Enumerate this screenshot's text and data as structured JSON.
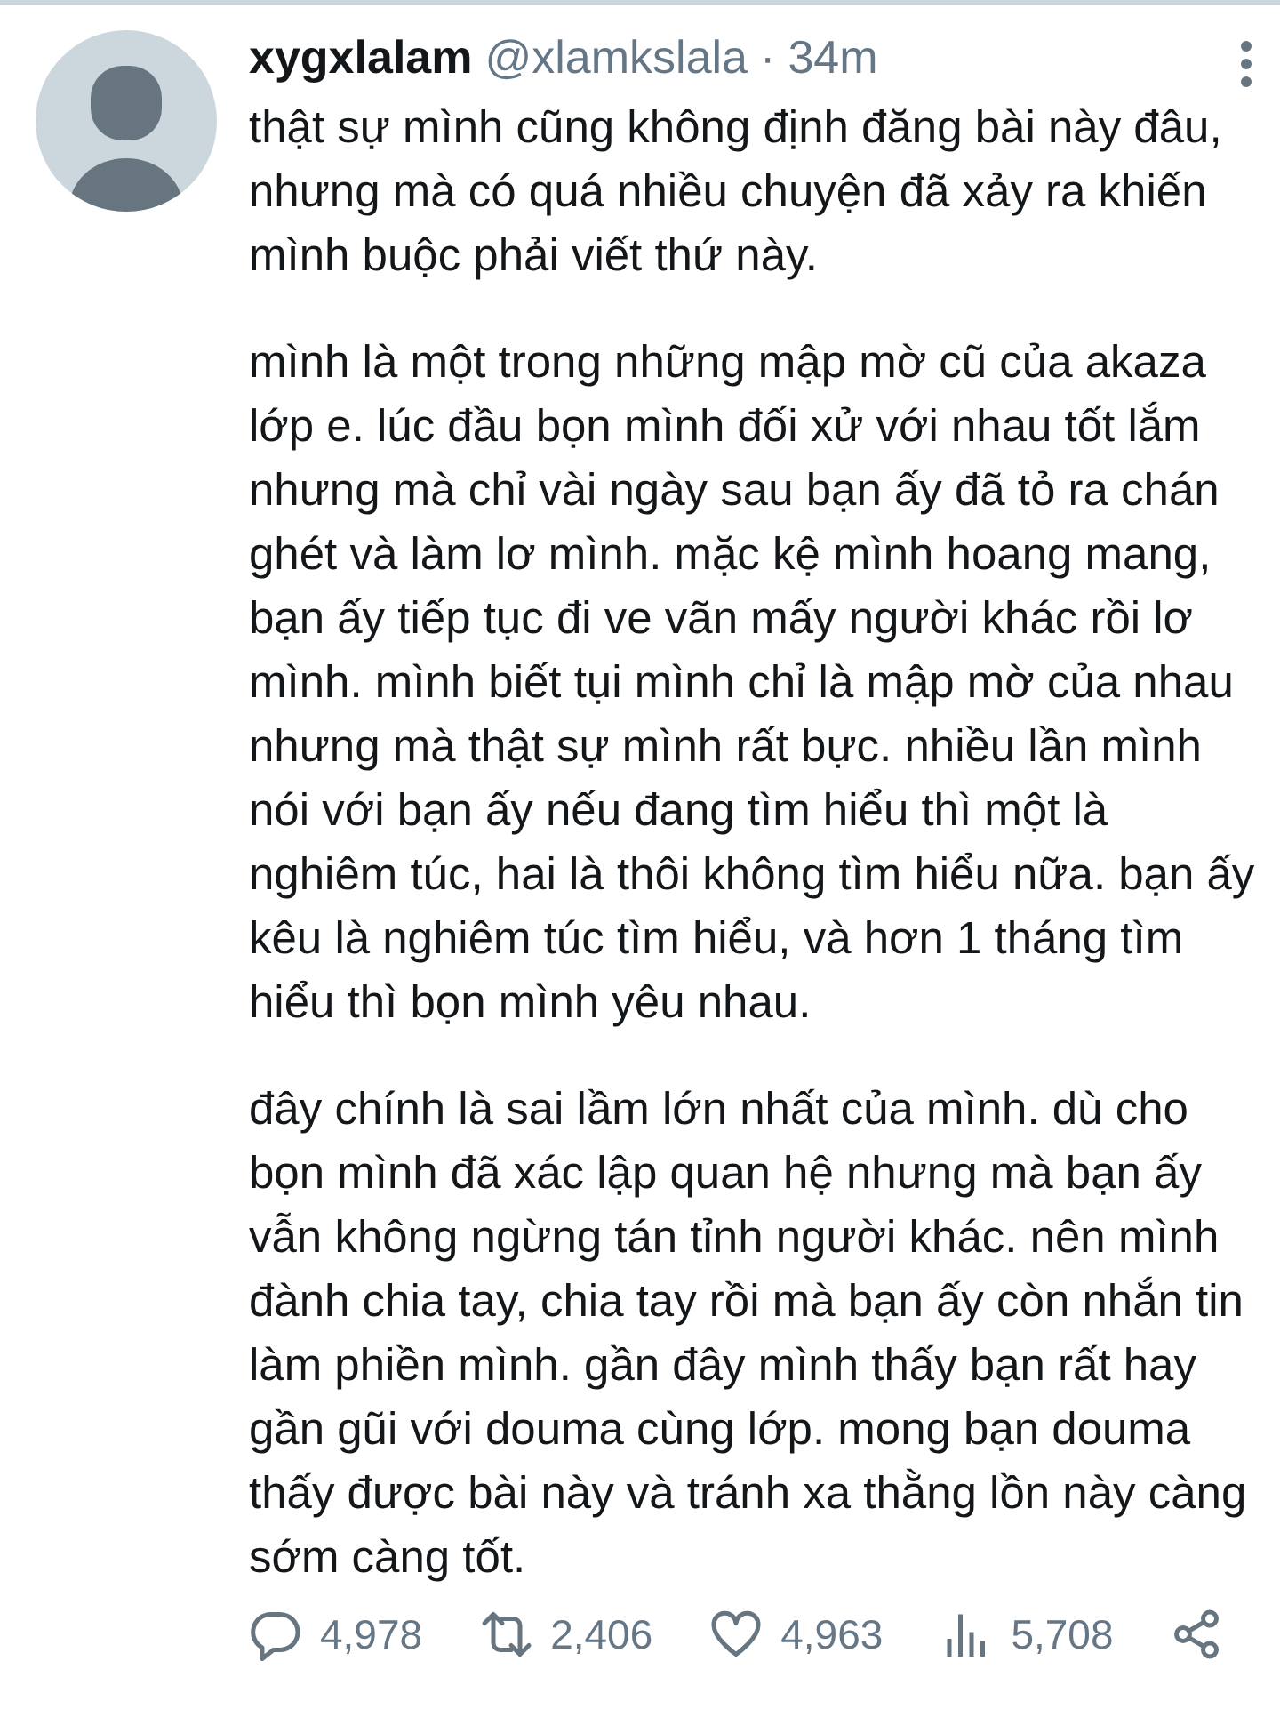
{
  "tweet": {
    "author": {
      "name": "xygxlalam",
      "handle": "@xlamkslala",
      "separator": "·",
      "time": "34m"
    },
    "paragraphs": [
      "thật sự mình cũng không định đăng bài này đâu, nhưng mà có quá nhiều chuyện đã xảy ra khiến mình buộc phải viết thứ này.",
      "mình là một trong những mập mờ cũ của akaza lớp e. lúc đầu bọn mình đối xử với nhau tốt lắm nhưng mà chỉ vài ngày sau bạn ấy đã tỏ ra chán ghét và làm lơ mình. mặc kệ mình hoang mang, bạn ấy tiếp tục đi ve vãn mấy người khác rồi lơ mình. mình biết tụi mình chỉ là mập mờ của nhau nhưng mà thật sự mình rất bực. nhiều lần mình nói với bạn ấy nếu đang tìm hiểu thì một là nghiêm túc, hai là thôi không tìm hiểu nữa. bạn ấy kêu là nghiêm túc tìm hiểu, và hơn 1 tháng tìm hiểu thì bọn mình yêu nhau.",
      "đây chính là sai lầm lớn nhất của mình. dù cho bọn mình đã xác lập quan hệ nhưng mà bạn ấy vẫn không ngừng tán tỉnh người khác. nên mình đành chia tay, chia tay rồi mà bạn ấy còn nhắn tin làm phiền mình. gần đây mình thấy bạn rất hay gần gũi với douma cùng lớp. mong bạn douma thấy được bài này và tránh xa thằng lồn này càng sớm càng tốt."
    ],
    "actions": [
      {
        "kind": "reply",
        "count": "4,978"
      },
      {
        "kind": "retweet",
        "count": "2,406"
      },
      {
        "kind": "like",
        "count": "4,963"
      },
      {
        "kind": "views",
        "count": "5,708"
      },
      {
        "kind": "share"
      }
    ]
  }
}
